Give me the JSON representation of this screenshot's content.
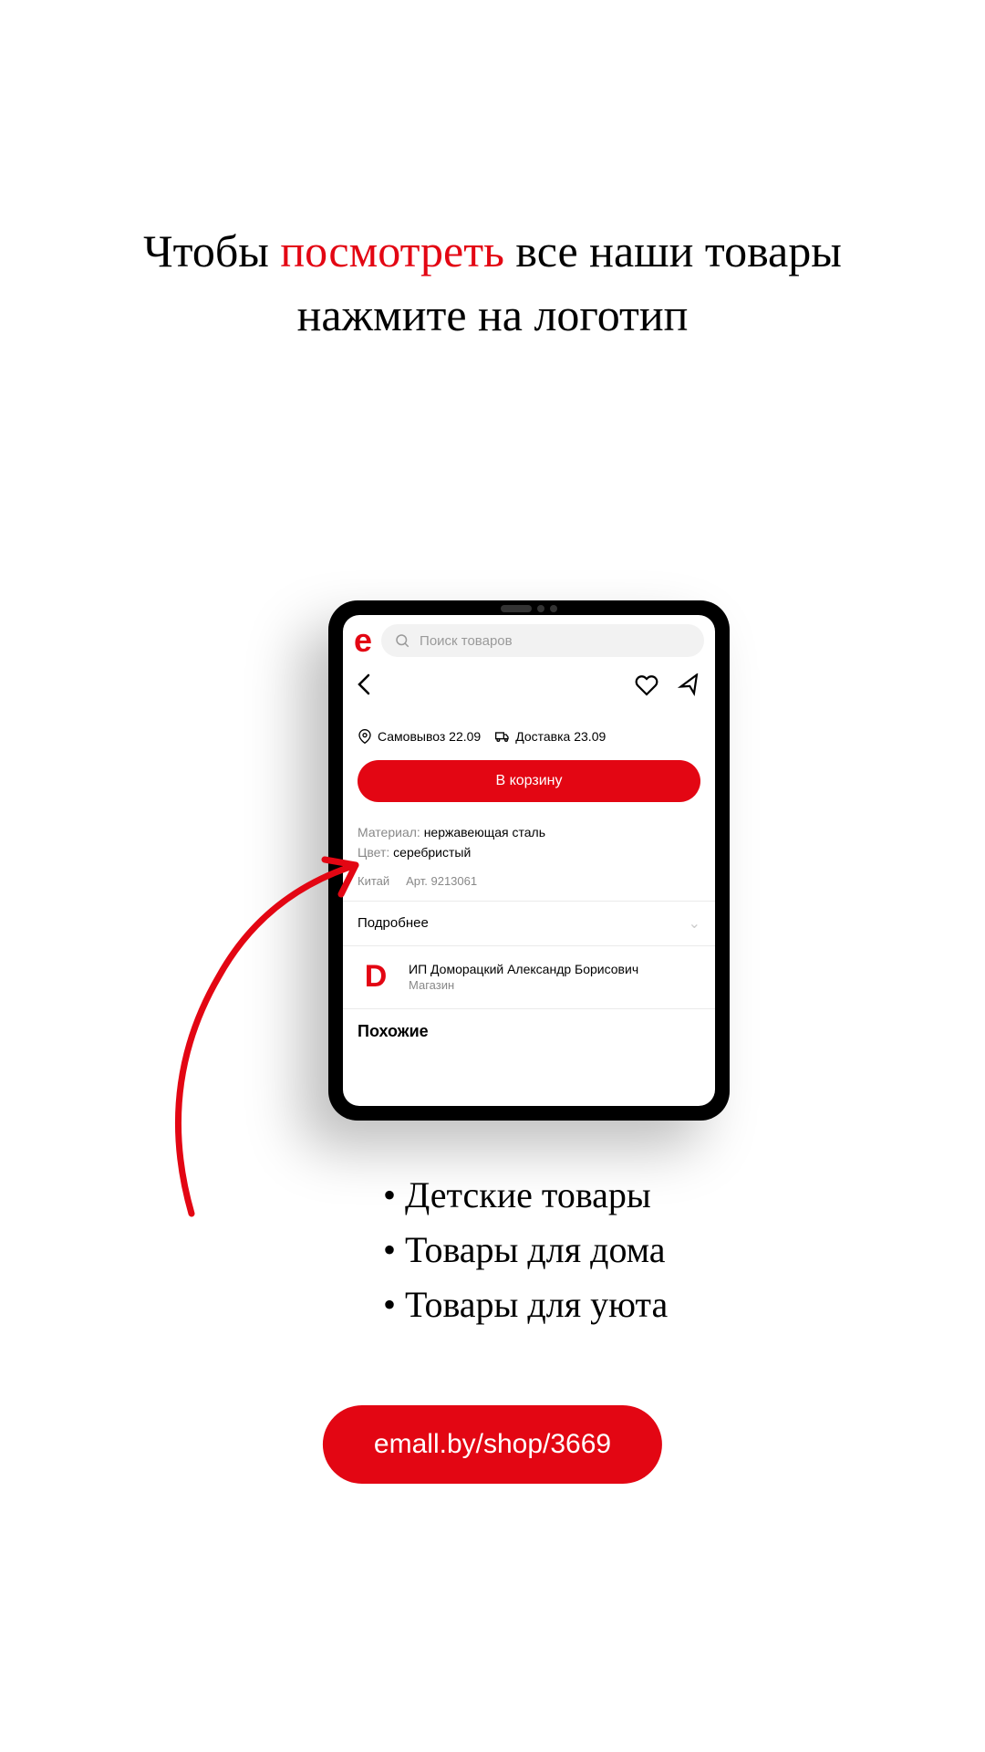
{
  "headline": {
    "part1": "Чтобы ",
    "accent": "посмотреть",
    "part2": " все наши товары",
    "line2": "нажмите на логотип"
  },
  "tablet": {
    "brand_logo": "e",
    "search_placeholder": "Поиск товаров",
    "delivery": {
      "pickup": "Самовывоз 22.09",
      "shipping": "Доставка 23.09"
    },
    "cart_label": "В корзину",
    "specs": {
      "material_label": "Материал: ",
      "material_value": "нержавеющая сталь",
      "color_label": "Цвет: ",
      "color_value": "серебристый"
    },
    "meta": {
      "country": "Китай",
      "article": "Арт. 9213061"
    },
    "expand_label": "Подробнее",
    "seller": {
      "logo": "D",
      "name": "ИП Доморацкий Александр Борисович",
      "type": "Магазин"
    },
    "similar_label": "Похожие"
  },
  "bullets": {
    "items": [
      "Детские товары",
      "Товары для дома",
      "Товары для уюта"
    ]
  },
  "url": "emall.by/shop/3669"
}
